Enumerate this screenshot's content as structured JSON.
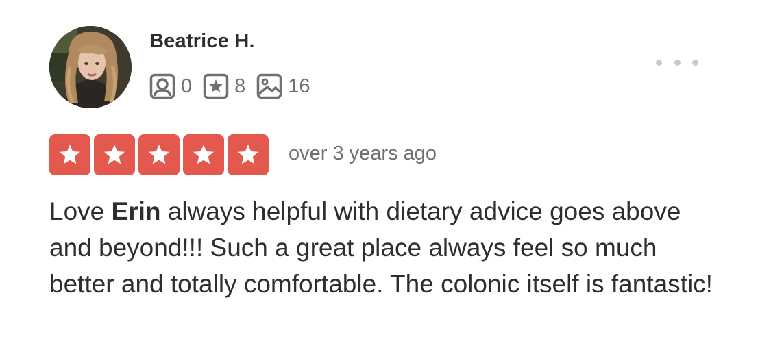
{
  "user": {
    "name": "Beatrice H.",
    "avatar_icon": "user-avatar-photo",
    "stats": [
      {
        "icon": "friends-icon",
        "count": "0"
      },
      {
        "icon": "reviews-star-icon",
        "count": "8"
      },
      {
        "icon": "photos-icon",
        "count": "16"
      }
    ]
  },
  "menu": {
    "icon": "more-options-icon"
  },
  "rating": {
    "stars": 5,
    "max": 5,
    "color": "#e4594e",
    "date": "over 3 years ago"
  },
  "review": {
    "part1": "Love ",
    "highlight": "Erin",
    "part2": " always helpful with dietary advice goes above and beyond!!! Such a great place always feel so much better and totally comfortable. The colonic itself is fantastic!"
  },
  "colors": {
    "text": "#2d2e2f",
    "muted": "#6e7072",
    "star_bg": "#e4594e"
  }
}
